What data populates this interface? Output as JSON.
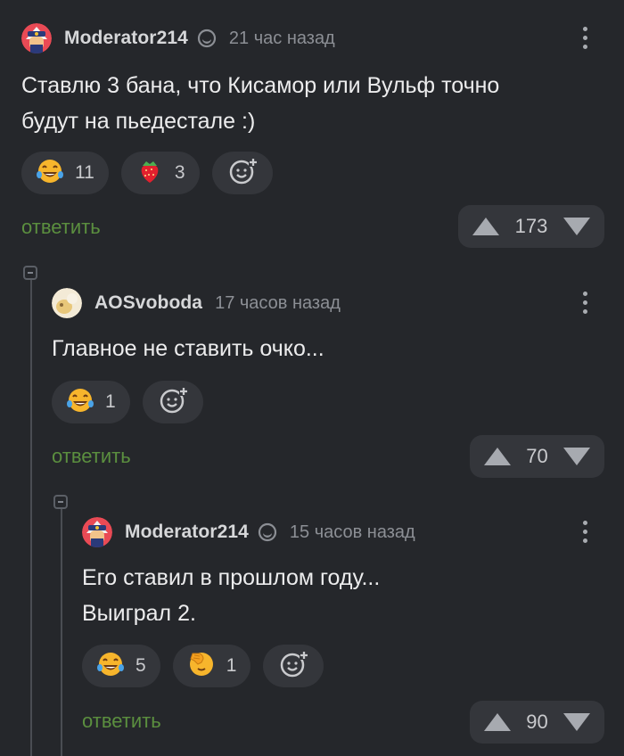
{
  "comments": [
    {
      "author": "Moderator214",
      "time": "21 час назад",
      "text_lines": [
        "Ставлю 3 бана, что Кисамор или Вульф точно",
        "будут на пьедестале :)"
      ],
      "reactions": [
        {
          "icon": "laughing-tears-emoji-icon",
          "count": "11"
        },
        {
          "icon": "strawberry-emoji-icon",
          "count": "3"
        }
      ],
      "reply_label": "ответить",
      "score": "173"
    },
    {
      "author": "AOSvoboda",
      "time": "17 часов назад",
      "text_lines": [
        "Главное не ставить очко..."
      ],
      "reactions": [
        {
          "icon": "laughing-tears-emoji-icon",
          "count": "1"
        }
      ],
      "reply_label": "ответить",
      "score": "70"
    },
    {
      "author": "Moderator214",
      "time": "15 часов назад",
      "text_lines": [
        "Его ставил в прошлом году...",
        "Выиграл 2."
      ],
      "reactions": [
        {
          "icon": "laughing-tears-emoji-icon",
          "count": "5"
        },
        {
          "icon": "facepalm-emoji-icon",
          "count": "1"
        }
      ],
      "reply_label": "ответить",
      "score": "90"
    }
  ],
  "colors": {
    "background": "#25272b",
    "pill": "#34363b",
    "reply": "#5b8f3f",
    "author": "#d6d7d9",
    "time": "#8c8f95"
  }
}
